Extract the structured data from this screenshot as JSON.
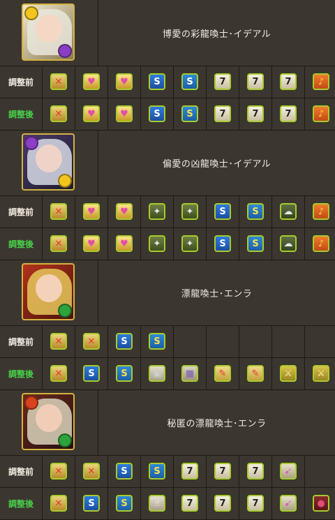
{
  "labels": {
    "before": "調整前",
    "after": "調整後"
  },
  "colors": {
    "bg": "#3b362f",
    "grid": "#1d1a16",
    "after_label": "#49d04a",
    "badge_border": "#a8cc2c"
  },
  "cards": [
    {
      "name": "博愛の彩龍喚士･イデアル",
      "portrait": {
        "theme": "light-gold",
        "orbs": [
          "gold",
          "purple"
        ]
      },
      "before": [
        "skill-boost-icon",
        "heart-orb-plus-icon",
        "heart-orb-plus-icon",
        "poison-resist-icon",
        "move-time-icon",
        "seven-combo-icon",
        "seven-combo-icon",
        "seven-combo-icon",
        "sound-icon"
      ],
      "after": [
        "skill-boost-icon",
        "heart-orb-plus-icon",
        "heart-orb-plus-icon",
        "poison-resist-icon",
        "move-time-plus-icon",
        "seven-combo-icon",
        "seven-combo-icon",
        "seven-combo-icon",
        "sound-icon"
      ]
    },
    {
      "name": "偏愛の凶龍喚士･イデアル",
      "portrait": {
        "theme": "dark-purple",
        "orbs": [
          "purple",
          "gold"
        ]
      },
      "before": [
        "skill-boost-icon",
        "heart-orb-plus-icon",
        "heart-orb-plus-icon",
        "skill-charge-icon",
        "skill-charge-icon",
        "poison-resist-icon",
        "move-time-plus-icon",
        "cloud-resist-icon",
        "sound-icon"
      ],
      "after": [
        "skill-boost-icon",
        "heart-orb-plus-icon",
        "heart-orb-plus-icon",
        "skill-charge-icon",
        "skill-charge-icon",
        "poison-resist-icon",
        "move-time-plus-icon",
        "cloud-resist-icon",
        "sound-icon"
      ]
    },
    {
      "name": "漂龍喚士･エンラ",
      "portrait": {
        "theme": "red-fire",
        "orbs": [
          "green"
        ]
      },
      "before": [
        "skill-boost-icon",
        "skill-boost-icon",
        "poison-resist-icon",
        "move-time-plus-icon"
      ],
      "after": [
        "skill-boost-icon",
        "poison-resist-icon",
        "move-time-plus-icon",
        "shield-icon",
        "team-icon",
        "enhance-combo-icon",
        "enhance-combo-icon",
        "sword-icon",
        "sword-icon"
      ]
    },
    {
      "name": "秘匿の漂龍喚士･エンラ",
      "portrait": {
        "theme": "dark-fire",
        "orbs": [
          "red",
          "green"
        ]
      },
      "before": [
        "skill-boost-icon",
        "skill-boost-icon",
        "poison-resist-icon",
        "move-time-plus-icon",
        "seven-combo-icon",
        "seven-combo-icon",
        "seven-combo-icon",
        "attack-up-icon"
      ],
      "after": [
        "skill-boost-icon",
        "poison-resist-icon",
        "move-time-plus-icon",
        "finger-icon",
        "seven-combo-icon",
        "seven-combo-icon",
        "seven-combo-icon",
        "attack-up-icon",
        "heart-orb-row-icon"
      ]
    }
  ]
}
